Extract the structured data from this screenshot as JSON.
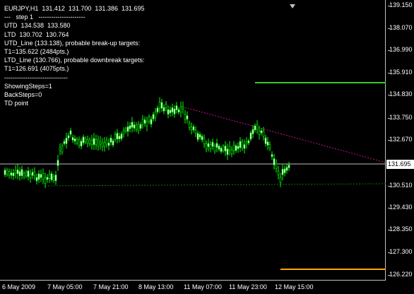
{
  "info_lines": [
    "EURJPY,H1  131.412  131.700  131.386  131.695",
    "---   step 1   ----------------------",
    "UTD  134.538  133.580",
    "LTD  130.702  130.764",
    "UTD_Line (133.138), probable break-up targets:",
    "T1=135.622 (2484pts.)",
    "LTD_Line (130.766), probable downbreak targets:",
    "T1=126.691 (4075pts.)",
    "------------------------------",
    "ShowingSteps=1",
    "BackSteps=0",
    "TD point"
  ],
  "price_scale": [
    "139.150",
    "138.070",
    "136.990",
    "135.910",
    "134.830",
    "133.750",
    "132.670",
    "131.695",
    "130.510",
    "129.430",
    "128.350",
    "127.300",
    "126.220"
  ],
  "current_price": "131.695",
  "time_scale": [
    "6 May 2009",
    "7 May 05:00",
    "7 May 21:00",
    "8 May 13:00",
    "11 May 07:00",
    "11 May 23:00",
    "12 May 15:00"
  ],
  "colors": {
    "background": "#000000",
    "candle": "#00ff00",
    "target_up": "#32cd32",
    "target_down": "#ffa500",
    "trendline_down": "#c71585",
    "support_line": "#008000",
    "price_line": "#c0c0c0"
  },
  "icons": {
    "shift_marker": "triangle-down-icon"
  }
}
